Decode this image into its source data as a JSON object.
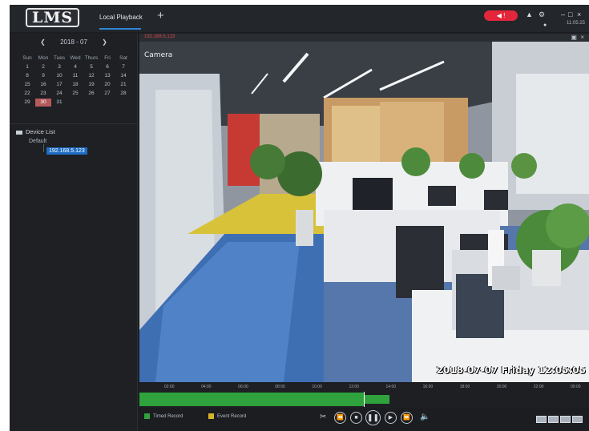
{
  "app": {
    "logo": "LMS",
    "tab": "Local Playback",
    "add_tab_icon": "plus-icon",
    "clock": "11:05:25"
  },
  "titlebar_icons": [
    "alarm-icon",
    "user-icon",
    "settings-icon",
    "minimize-icon",
    "restore-icon",
    "close-icon"
  ],
  "calendar": {
    "month_label": "2018 - 07",
    "weekdays": [
      "Sun",
      "Mon",
      "Tues",
      "Wed",
      "Thurs",
      "Fri",
      "Sat"
    ],
    "days": [
      [
        "1",
        "2",
        "3",
        "4",
        "5",
        "6",
        "7"
      ],
      [
        "8",
        "9",
        "10",
        "11",
        "12",
        "13",
        "14"
      ],
      [
        "15",
        "16",
        "17",
        "18",
        "19",
        "20",
        "21"
      ],
      [
        "22",
        "23",
        "24",
        "25",
        "26",
        "27",
        "28"
      ],
      [
        "29",
        "30",
        "31",
        "",
        "",
        "",
        ""
      ]
    ],
    "recorded_day": "30"
  },
  "device_list": {
    "title": "Device List",
    "group": "Default",
    "device": "192.168.5.123"
  },
  "video": {
    "channel": "192.168.5.123",
    "camera_name": "Camera",
    "timestamp": "2018-07-07 Friday 12:05:05"
  },
  "timeline": {
    "labels": [
      "02:00",
      "04:00",
      "06:00",
      "08:00",
      "10:00",
      "12:00",
      "14:00",
      "16:00",
      "18:00",
      "20:00",
      "22:00",
      "00:00"
    ]
  },
  "legend": {
    "timed": "Timed Record",
    "event": "Event Record",
    "timed_color": "#2fa23d",
    "event_color": "#d4b52a"
  },
  "accent": "#2e86d6"
}
